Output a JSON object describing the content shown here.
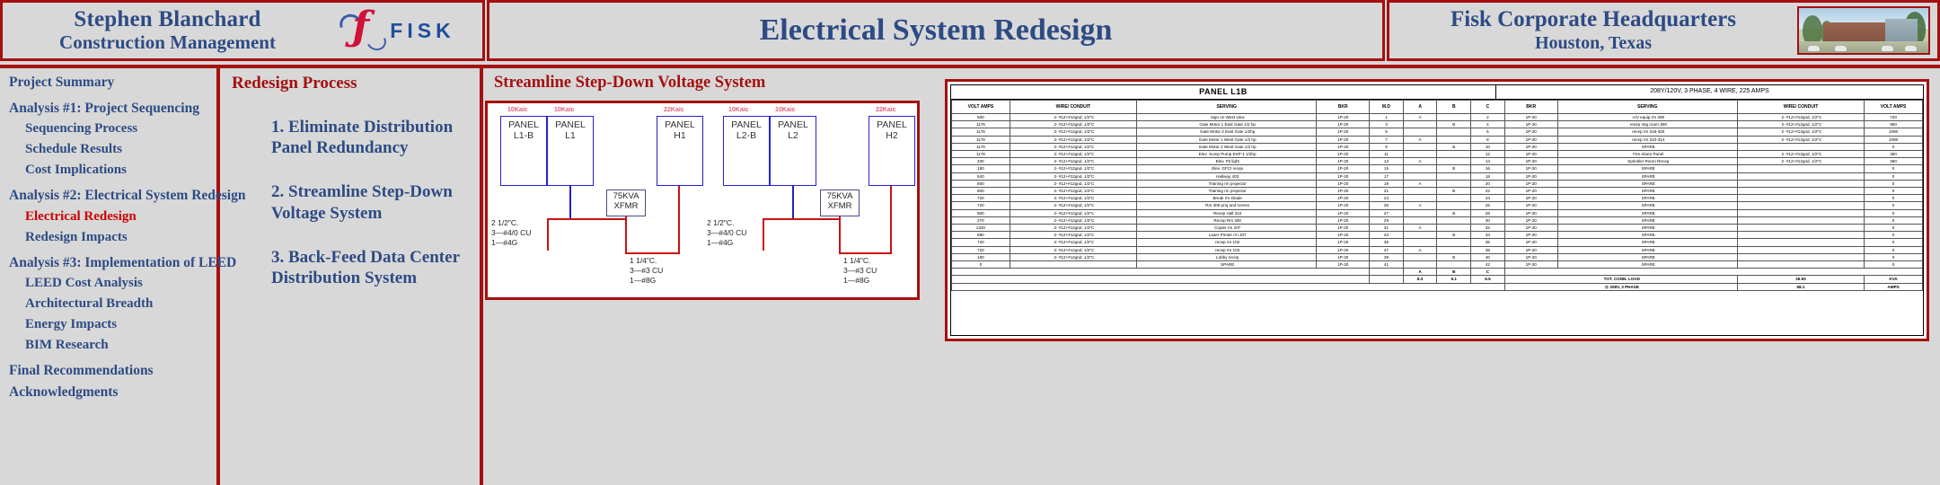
{
  "header": {
    "author_name": "Stephen Blanchard",
    "author_role": "Construction Management",
    "logo_word": "FISK",
    "logo_mark": "fisk-script-f-icon",
    "center_title": "Electrical System Redesign",
    "project_name": "Fisk Corporate Headquarters",
    "project_location": "Houston, Texas",
    "building_photo_alt": "fisk-headquarters-building-photo"
  },
  "sidebar": {
    "items": [
      {
        "label": "Project Summary",
        "level": 1,
        "active": false,
        "gap": false
      },
      {
        "label": "Analysis #1: Project Sequencing",
        "level": 1,
        "active": false,
        "gap": true
      },
      {
        "label": "Sequencing Process",
        "level": 2,
        "active": false,
        "gap": false
      },
      {
        "label": "Schedule Results",
        "level": 2,
        "active": false,
        "gap": false
      },
      {
        "label": "Cost Implications",
        "level": 2,
        "active": false,
        "gap": false
      },
      {
        "label": "Analysis #2: Electrical System Redesign",
        "level": 1,
        "active": false,
        "gap": true
      },
      {
        "label": "Electrical Redesign",
        "level": 2,
        "active": true,
        "gap": false
      },
      {
        "label": "Redesign Impacts",
        "level": 2,
        "active": false,
        "gap": false
      },
      {
        "label": "Analysis #3: Implementation of LEED",
        "level": 1,
        "active": false,
        "gap": true
      },
      {
        "label": "LEED Cost Analysis",
        "level": 2,
        "active": false,
        "gap": false
      },
      {
        "label": "Architectural Breadth",
        "level": 2,
        "active": false,
        "gap": false
      },
      {
        "label": "Energy Impacts",
        "level": 2,
        "active": false,
        "gap": false
      },
      {
        "label": "BIM Research",
        "level": 2,
        "active": false,
        "gap": false
      },
      {
        "label": "Final Recommendations",
        "level": 1,
        "active": false,
        "gap": true
      },
      {
        "label": "Acknowledgments",
        "level": 1,
        "active": false,
        "gap": false
      }
    ]
  },
  "process": {
    "heading": "Redesign Process",
    "steps": [
      "1. Eliminate Distribution Panel Redundancy",
      "2. Streamline Step-Down Voltage System",
      "3. Back-Feed Data Center Distribution System"
    ]
  },
  "diagram": {
    "heading": "Streamline Step-Down Voltage System",
    "kaic_labels": [
      "10Kaic",
      "10Kaic",
      "22Kaic",
      "10Kaic",
      "10Kaic",
      "22Kaic"
    ],
    "panels": [
      {
        "line1": "PANEL",
        "line2": "L1-B"
      },
      {
        "line1": "PANEL",
        "line2": "L1"
      },
      {
        "line1": "PANEL",
        "line2": "H1"
      },
      {
        "line1": "PANEL",
        "line2": "L2-B"
      },
      {
        "line1": "PANEL",
        "line2": "L2"
      },
      {
        "line1": "PANEL",
        "line2": "H2"
      }
    ],
    "transformers": [
      {
        "line1": "75KVA",
        "line2": "XFMR"
      },
      {
        "line1": "75KVA",
        "line2": "XFMR"
      }
    ],
    "feeder_specs": [
      "2 1/2\"C.\n3—#4/0 CU\n1—#4G",
      "1 1/4\"C.\n3—#3 CU\n1—#8G",
      "2 1/2\"C.\n3—#4/0 CU\n1—#4G",
      "1 1/4\"C.\n3—#3 CU\n1—#8G"
    ]
  },
  "schedule": {
    "title": "PANEL L1B",
    "subtitle": "208Y/120V, 3 PHASE, 4 WIRE, 225 AMPS",
    "columns": [
      "VOLT AMPS",
      "WIRE/ CONDUIT",
      "SERVING",
      "BKR",
      "M.D",
      "A",
      "B",
      "C",
      "BKR",
      "SERVING",
      "WIRE/ CONDUIT",
      "VOLT AMPS"
    ],
    "md_subcolumns": [
      "A",
      "B",
      "C"
    ],
    "rows": [
      {
        "va_l": "500",
        "wire_l": "2- #12+#12gnd, 1/2\"C",
        "serv_l": "Sign on West view",
        "bkr_l": "1P-20",
        "md": "1",
        "a": "A",
        "b": "",
        "c": "2",
        "bkr_r": "1P-20",
        "serv_r": "A/V equip rm 309",
        "wire_r": "2- #12+#12gnd, 1/2\"C",
        "va_r": "720"
      },
      {
        "va_l": "1176",
        "wire_l": "2- #12+#12gnd, 1/2\"C",
        "serv_l": "Gate Motor 1 East Gate 1/2 hp",
        "bkr_l": "1P-20",
        "md": "3",
        "a": "",
        "b": "B",
        "c": "4",
        "bkr_r": "1P-20",
        "serv_r": "recep mtg room 309",
        "wire_r": "2- #12+#12gnd, 1/2\"C",
        "va_r": "900"
      },
      {
        "va_l": "1176",
        "wire_l": "2- #12+#12gnd, 1/2\"C",
        "serv_l": "Gate Motor 2 East Gate 1/2hp",
        "bkr_l": "1P-20",
        "md": "5",
        "a": "",
        "b": "",
        "c": "6",
        "bkr_r": "1P-20",
        "serv_r": "recep rm 318-320",
        "wire_r": "2- #12+#12gnd, 1/2\"C",
        "va_r": "1080"
      },
      {
        "va_l": "1176",
        "wire_l": "2- #12+#12gnd, 1/2\"C",
        "serv_l": "Gate Motor 1 West Gate 1/2 hp",
        "bkr_l": "1P-20",
        "md": "7",
        "a": "A",
        "b": "",
        "c": "8",
        "bkr_r": "1P-20",
        "serv_r": "recep rm 310-314",
        "wire_r": "2- #12+#12gnd, 1/2\"C",
        "va_r": "1080"
      },
      {
        "va_l": "1176",
        "wire_l": "2- #12+#12gnd, 1/2\"C",
        "serv_l": "Gate Motor 2 West Gate 1/2 hp",
        "bkr_l": "1P-20",
        "md": "9",
        "a": "",
        "b": "B",
        "c": "10",
        "bkr_r": "1P-20",
        "serv_r": "SPARE",
        "wire_r": "",
        "va_r": "0"
      },
      {
        "va_l": "1176",
        "wire_l": "2- #12+#12gnd, 1/2\"C",
        "serv_l": "Elev. Sump Pump ESP-1 1/2hp",
        "bkr_l": "1P-20",
        "md": "11",
        "a": "",
        "b": "",
        "c": "12",
        "bkr_r": "1P-20",
        "serv_r": "Fire Alarm Panel",
        "wire_r": "2- #12+#12gnd, 1/2\"C",
        "va_r": "360"
      },
      {
        "va_l": "330",
        "wire_l": "2- #12+#12gnd, 1/2\"C",
        "serv_l": "Elev. Pit light",
        "bkr_l": "1P-20",
        "md": "13",
        "a": "A",
        "b": "",
        "c": "14",
        "bkr_r": "1P-20",
        "serv_r": "Sprinkler Room Recep",
        "wire_r": "2- #12+#12gnd, 1/2\"C",
        "va_r": "360"
      },
      {
        "va_l": "180",
        "wire_l": "2- #12+#12gnd, 1/2\"C",
        "serv_l": "Elev. GFCI recep",
        "bkr_l": "1P-20",
        "md": "15",
        "a": "",
        "b": "B",
        "c": "16",
        "bkr_r": "1P-20",
        "serv_r": "SPARE",
        "wire_r": "",
        "va_r": "0"
      },
      {
        "va_l": "540",
        "wire_l": "2- #12+#12gnd, 1/2\"C",
        "serv_l": "Hallway 403",
        "bkr_l": "1P-20",
        "md": "17",
        "a": "",
        "b": "",
        "c": "18",
        "bkr_r": "1P-20",
        "serv_r": "SPARE",
        "wire_r": "",
        "va_r": "0"
      },
      {
        "va_l": "800",
        "wire_l": "2- #12+#12gnd, 1/2\"C",
        "serv_l": "Training rm projector",
        "bkr_l": "1P-20",
        "md": "19",
        "a": "A",
        "b": "",
        "c": "20",
        "bkr_r": "1P-20",
        "serv_r": "SPARE",
        "wire_r": "",
        "va_r": "0"
      },
      {
        "va_l": "800",
        "wire_l": "2- #12+#12gnd, 1/2\"C",
        "serv_l": "Training rm projector",
        "bkr_l": "1P-20",
        "md": "21",
        "a": "",
        "b": "B",
        "c": "22",
        "bkr_r": "1P-20",
        "serv_r": "SPARE",
        "wire_r": "",
        "va_r": "0"
      },
      {
        "va_l": "720",
        "wire_l": "2- #12+#12gnd, 1/2\"C",
        "serv_l": "Break rm shade",
        "bkr_l": "1P-20",
        "md": "23",
        "a": "",
        "b": "",
        "c": "24",
        "bkr_r": "1P-20",
        "serv_r": "SPARE",
        "wire_r": "",
        "va_r": "0"
      },
      {
        "va_l": "720",
        "wire_l": "2- #12+#12gnd, 1/2\"C",
        "serv_l": "Rm 309 proj and screen",
        "bkr_l": "1P-20",
        "md": "25",
        "a": "A",
        "b": "",
        "c": "26",
        "bkr_r": "1P-20",
        "serv_r": "SPARE",
        "wire_r": "",
        "va_r": "0"
      },
      {
        "va_l": "900",
        "wire_l": "2- #12+#12gnd, 1/2\"C",
        "serv_l": "Recep Hall 310",
        "bkr_l": "1P-20",
        "md": "27",
        "a": "",
        "b": "B",
        "c": "28",
        "bkr_r": "1P-20",
        "serv_r": "SPARE",
        "wire_r": "",
        "va_r": "0"
      },
      {
        "va_l": "270",
        "wire_l": "2- #12+#12gnd, 1/2\"C",
        "serv_l": "Recep Rm 300",
        "bkr_l": "1P-20",
        "md": "29",
        "a": "",
        "b": "",
        "c": "30",
        "bkr_r": "1P-20",
        "serv_r": "SPARE",
        "wire_r": "",
        "va_r": "0"
      },
      {
        "va_l": "1320",
        "wire_l": "2- #12+#12gnd, 1/2\"C",
        "serv_l": "Copier rm 207",
        "bkr_l": "1P-20",
        "md": "31",
        "a": "A",
        "b": "",
        "c": "32",
        "bkr_r": "1P-20",
        "serv_r": "SPARE",
        "wire_r": "",
        "va_r": "0"
      },
      {
        "va_l": "980",
        "wire_l": "2- #12+#12gnd, 1/2\"C",
        "serv_l": "Laser Printer rm 207",
        "bkr_l": "1P-20",
        "md": "33",
        "a": "",
        "b": "B",
        "c": "34",
        "bkr_r": "1P-20",
        "serv_r": "SPARE",
        "wire_r": "",
        "va_r": "0"
      },
      {
        "va_l": "720",
        "wire_l": "2- #12+#12gnd, 1/2\"C",
        "serv_l": "recep rm 102",
        "bkr_l": "1P-20",
        "md": "35",
        "a": "",
        "b": "",
        "c": "36",
        "bkr_r": "1P-20",
        "serv_r": "SPARE",
        "wire_r": "",
        "va_r": "0"
      },
      {
        "va_l": "720",
        "wire_l": "2- #12+#12gnd, 1/2\"C",
        "serv_l": "recep rm 103",
        "bkr_l": "1P-20",
        "md": "37",
        "a": "A",
        "b": "",
        "c": "38",
        "bkr_r": "1P-20",
        "serv_r": "SPARE",
        "wire_r": "",
        "va_r": "0"
      },
      {
        "va_l": "180",
        "wire_l": "2- #12+#12gnd, 1/2\"C",
        "serv_l": "Lobby recep",
        "bkr_l": "1P-20",
        "md": "39",
        "a": "",
        "b": "B",
        "c": "40",
        "bkr_r": "1P-20",
        "serv_r": "SPARE",
        "wire_r": "",
        "va_r": "0"
      },
      {
        "va_l": "0",
        "wire_l": "",
        "serv_l": "SPARE",
        "bkr_l": "1P-20",
        "md": "41",
        "a": "",
        "b": "",
        "c": "42",
        "bkr_r": "1P-20",
        "serv_r": "SPARE",
        "wire_r": "",
        "va_r": "0"
      }
    ],
    "phase_header": [
      "A",
      "B",
      "C"
    ],
    "phase_totals": [
      "8.3",
      "6.1",
      "6.5"
    ],
    "total_label": "TOT. CONN. LOAD",
    "total_kva": "26.93",
    "total_kva_unit": "KVA",
    "amps_note": "@ 208V, 3 PHASE",
    "total_amps": "58.1",
    "total_amps_unit": "AMPS"
  },
  "colors": {
    "accent_red": "#a51010",
    "heading_blue": "#2d4b84",
    "active_red": "#cc0000",
    "background": "#d8d8d8",
    "wire_red": "#cc1111",
    "panel_blue": "#2222cc",
    "kaic_pink": "#e0607a"
  }
}
